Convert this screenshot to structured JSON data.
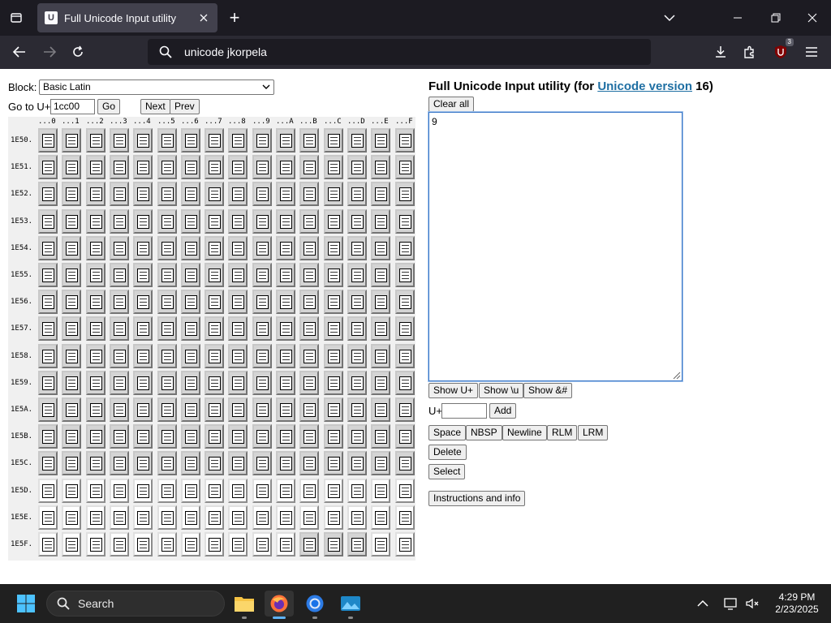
{
  "browser": {
    "tab_title": "Full Unicode Input utility",
    "favicon_letter": "U",
    "url_text": "unicode jkorpela",
    "ublock_badge": "3",
    "new_tab": "+"
  },
  "page": {
    "block_label": "Block:",
    "block_selected": "Basic Latin",
    "goto_label": "Go to U+",
    "goto_value": "1cc00",
    "go_label": "Go",
    "next_label": "Next",
    "prev_label": "Prev",
    "heading_prefix": "Full Unicode Input utility (for ",
    "heading_link": "Unicode version",
    "heading_suffix": " 16)",
    "clear_label": "Clear all",
    "text_value": "9",
    "show_uplus_label": "Show U+",
    "show_u_label": "Show \\u",
    "show_amp_label": "Show &#",
    "uplus_label": "U+",
    "uplus_value": "",
    "add_label": "Add",
    "space_label": "Space",
    "nbsp_label": "NBSP",
    "newline_label": "Newline",
    "rlm_label": "RLM",
    "lrm_label": "LRM",
    "delete_label": "Delete",
    "select_label": "Select",
    "instructions_label": "Instructions and info"
  },
  "grid": {
    "column_headers": [
      "...0",
      "...1",
      "...2",
      "...3",
      "...4",
      "...5",
      "...6",
      "...7",
      "...8",
      "...9",
      "...A",
      "...B",
      "...C",
      "...D",
      "...E",
      "...F"
    ],
    "rows": [
      {
        "label": "1E50.",
        "white": []
      },
      {
        "label": "1E51.",
        "white": []
      },
      {
        "label": "1E52.",
        "white": []
      },
      {
        "label": "1E53.",
        "white": []
      },
      {
        "label": "1E54.",
        "white": []
      },
      {
        "label": "1E55.",
        "white": []
      },
      {
        "label": "1E56.",
        "white": []
      },
      {
        "label": "1E57.",
        "white": []
      },
      {
        "label": "1E58.",
        "white": []
      },
      {
        "label": "1E59.",
        "white": []
      },
      {
        "label": "1E5A.",
        "white": []
      },
      {
        "label": "1E5B.",
        "white": []
      },
      {
        "label": "1E5C.",
        "white": []
      },
      {
        "label": "1E5D.",
        "white": [
          0,
          1,
          2,
          3,
          4,
          5,
          6,
          7,
          8,
          9,
          10,
          11,
          12,
          13,
          14,
          15
        ]
      },
      {
        "label": "1E5E.",
        "white": [
          0,
          1,
          2,
          3,
          4,
          5,
          6,
          7,
          8,
          9,
          10,
          11,
          12,
          13,
          14,
          15
        ]
      },
      {
        "label": "1E5F.",
        "white": [
          0,
          1,
          2,
          3,
          4,
          5,
          6,
          7,
          8,
          9,
          10,
          14,
          15
        ]
      }
    ]
  },
  "taskbar": {
    "search_label": "Search",
    "time": "4:29 PM",
    "date": "2/23/2025"
  }
}
